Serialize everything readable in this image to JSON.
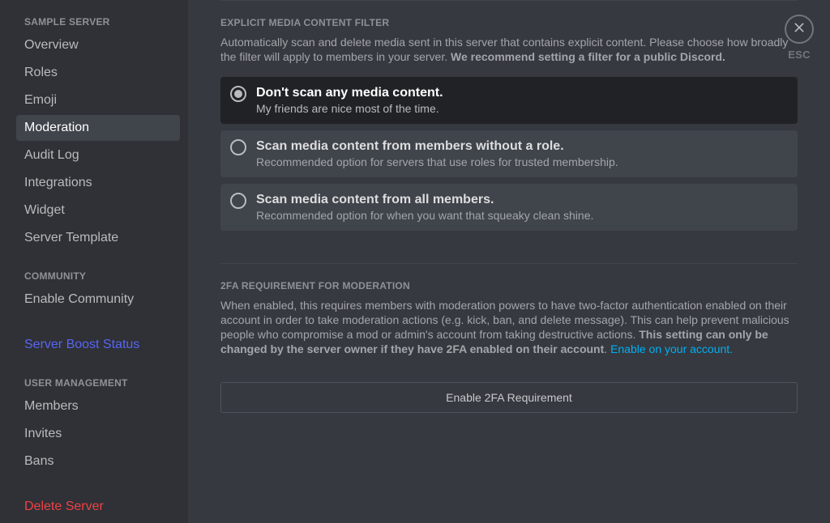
{
  "sidebar": {
    "server_header": "SAMPLE SERVER",
    "community_header": "COMMUNITY",
    "user_mgmt_header": "USER MANAGEMENT",
    "items": {
      "overview": "Overview",
      "roles": "Roles",
      "emoji": "Emoji",
      "moderation": "Moderation",
      "audit_log": "Audit Log",
      "integrations": "Integrations",
      "widget": "Widget",
      "server_template": "Server Template",
      "enable_community": "Enable Community",
      "server_boost": "Server Boost Status",
      "members": "Members",
      "invites": "Invites",
      "bans": "Bans",
      "delete_server": "Delete Server"
    }
  },
  "close_label": "ESC",
  "explicit_filter": {
    "title": "EXPLICIT MEDIA CONTENT FILTER",
    "desc_plain": "Automatically scan and delete media sent in this server that contains explicit content. Please choose how broadly the filter will apply to members in your server. ",
    "desc_bold": "We recommend setting a filter for a public Discord.",
    "options": [
      {
        "title": "Don't scan any media content.",
        "sub": "My friends are nice most of the time."
      },
      {
        "title": "Scan media content from members without a role.",
        "sub": "Recommended option for servers that use roles for trusted membership."
      },
      {
        "title": "Scan media content from all members.",
        "sub": "Recommended option for when you want that squeaky clean shine."
      }
    ]
  },
  "twofa": {
    "title": "2FA REQUIREMENT FOR MODERATION",
    "desc_plain": "When enabled, this requires members with moderation powers to have two-factor authentication enabled on their account in order to take moderation actions (e.g. kick, ban, and delete message). This can help prevent malicious people who compromise a mod or admin's account from taking destructive actions. ",
    "desc_bold": "This setting can only be changed by the server owner if they have 2FA enabled on their account",
    "desc_period": ". ",
    "link_text": "Enable on your account.",
    "button": "Enable 2FA Requirement"
  }
}
